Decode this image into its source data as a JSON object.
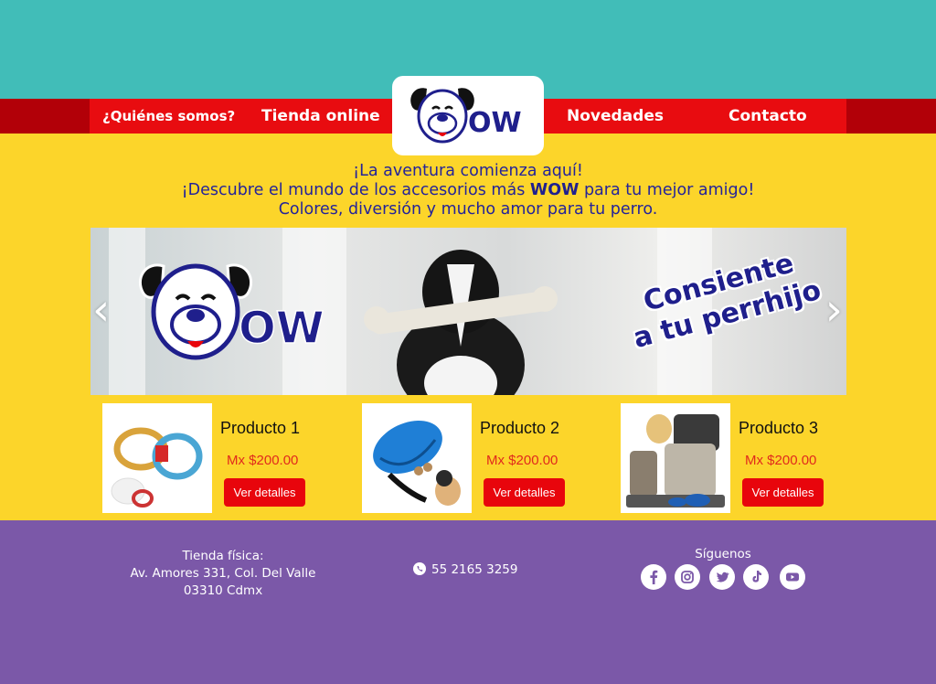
{
  "nav": {
    "items": [
      {
        "label": "¿Quiénes somos?"
      },
      {
        "label": "Tienda online"
      },
      {
        "label": "Novedades"
      },
      {
        "label": "Contacto"
      }
    ]
  },
  "brand": {
    "logo_text": "WOW",
    "colors": {
      "primary": "#e80c10",
      "navy": "#1f1f8c",
      "teal": "#41bdb8",
      "yellow": "#fcd52a",
      "purple": "#7b58a8"
    }
  },
  "intro": {
    "line1": "¡La aventura comienza aquí!",
    "line2_pre": "¡Descubre el mundo de los accesorios más ",
    "line2_wow": "WOW",
    "line2_post": " para tu mejor amigo!",
    "line3": "Colores, diversión y mucho amor para tu perro."
  },
  "banner": {
    "slogan_line1": "Consiente",
    "slogan_line2": "a tu perrhijo",
    "prev_icon": "chevron-left-icon",
    "next_icon": "chevron-right-icon"
  },
  "products": [
    {
      "name": "Producto 1",
      "price": "Mx $200.00",
      "button": "Ver detalles",
      "image": "rope-toy"
    },
    {
      "name": "Producto 2",
      "price": "Mx $200.00",
      "button": "Ver detalles",
      "image": "rubber-ball-toy"
    },
    {
      "name": "Producto 3",
      "price": "Mx $200.00",
      "button": "Ver detalles",
      "image": "travel-bag-kit"
    }
  ],
  "footer": {
    "store_title": "Tienda física:",
    "store_address": "Av. Amores 331, Col. Del Valle",
    "store_zip": "03310 Cdmx",
    "phone": "55 2165 3259",
    "follow": "Síguenos",
    "socials": [
      "facebook-icon",
      "instagram-icon",
      "twitter-icon",
      "tiktok-icon",
      "youtube-icon"
    ]
  }
}
